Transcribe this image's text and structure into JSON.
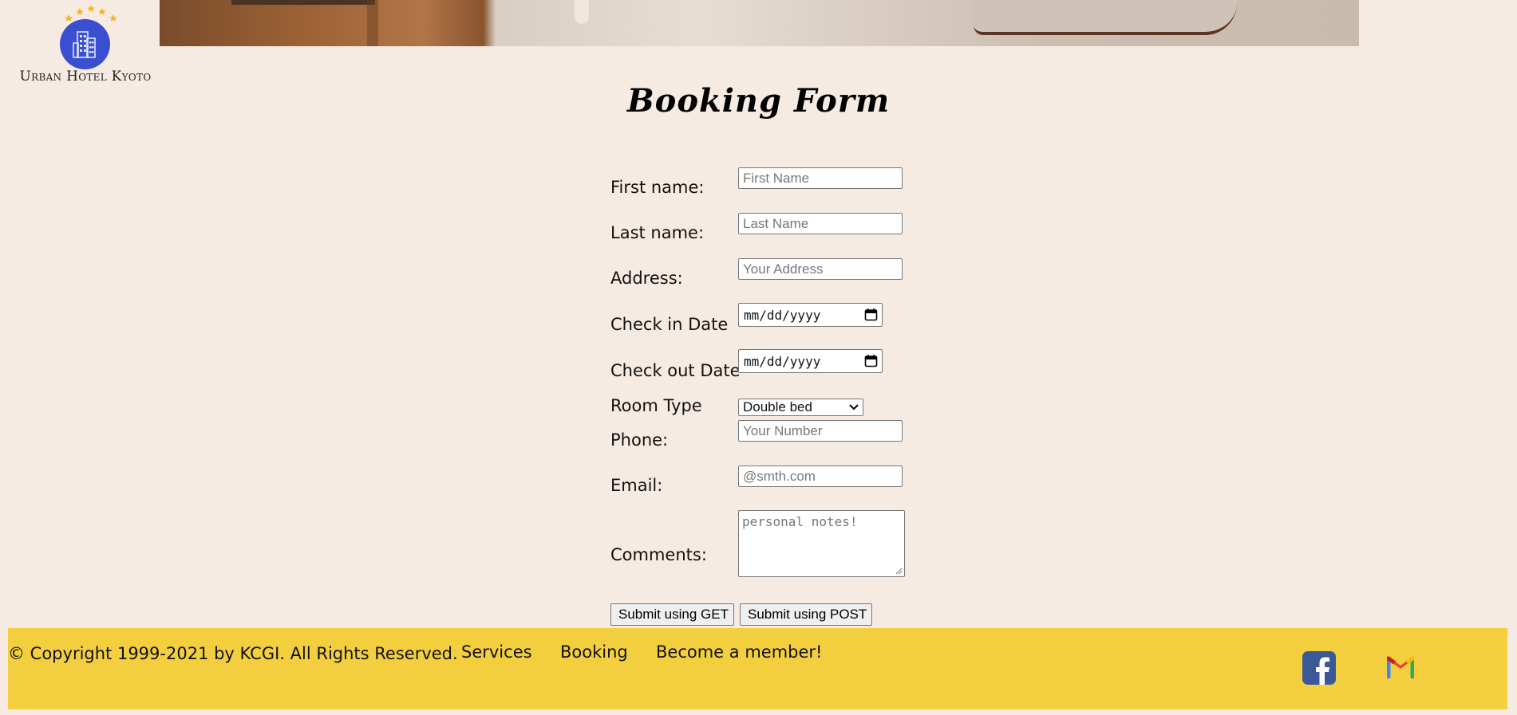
{
  "brand": {
    "name": "Urban Hotel Kyoto",
    "colors": {
      "accent": "#3a4fd0",
      "star": "#f2b61a",
      "footer": "#f3cf3f",
      "background": "#f6ebe3"
    }
  },
  "form": {
    "title": "Booking Form",
    "fields": {
      "first_name": {
        "label": "First name:",
        "placeholder": "First Name",
        "value": ""
      },
      "last_name": {
        "label": "Last name:",
        "placeholder": "Last Name",
        "value": ""
      },
      "address": {
        "label": "Address:",
        "placeholder": "Your Address",
        "value": ""
      },
      "check_in": {
        "label": "Check in Date",
        "placeholder": "mm/dd/yyyy"
      },
      "check_out": {
        "label": "Check out Date",
        "placeholder": "mm/dd/yyyy"
      },
      "room_type": {
        "label": "Room Type",
        "selected": "Double bed"
      },
      "phone": {
        "label": "Phone:",
        "placeholder": "Your Number",
        "value": ""
      },
      "email": {
        "label": "Email:",
        "placeholder": "@smth.com",
        "value": ""
      },
      "comments": {
        "label": "Comments:",
        "placeholder": "personal notes!"
      }
    },
    "buttons": {
      "submit_get": "Submit using GET",
      "submit_post": "Submit using POST"
    }
  },
  "footer": {
    "copyright": "© Copyright 1999-2021 by KCGI. All Rights Reserved.",
    "links": {
      "services": "Services",
      "booking": "Booking",
      "member": "Become a member!"
    },
    "social_icons": [
      "facebook-icon",
      "gmail-icon"
    ]
  }
}
